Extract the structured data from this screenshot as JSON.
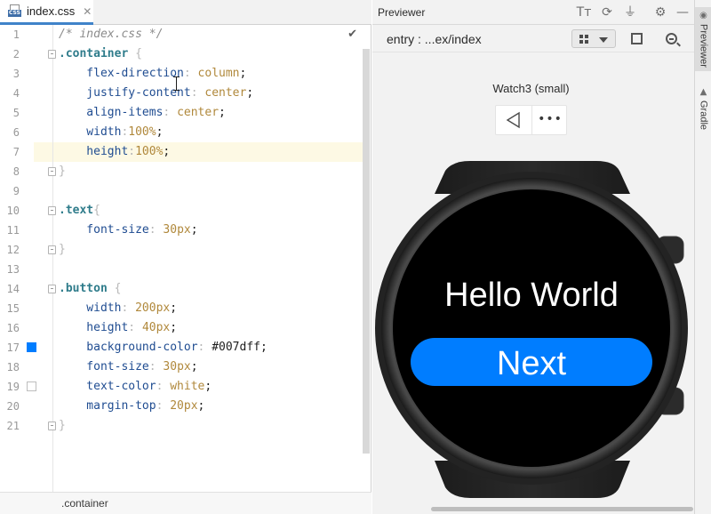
{
  "editor": {
    "tab": {
      "title": "index.css",
      "icon": "css-file-icon",
      "icon_text": "CSS",
      "close": "✕"
    },
    "lines": [
      {
        "n": "1",
        "tokens": [
          {
            "t": "/* index.css */",
            "c": "comment"
          }
        ]
      },
      {
        "n": "2",
        "fold": true,
        "tokens": [
          {
            "t": ".container",
            "c": "sel"
          },
          {
            "t": " {",
            "c": "brace"
          }
        ]
      },
      {
        "n": "3",
        "tokens": [
          {
            "t": "    flex-direction",
            "c": "prop"
          },
          {
            "t": ": ",
            "c": "brace"
          },
          {
            "t": "column",
            "c": "value"
          },
          {
            "t": ";",
            "c": "punct"
          }
        ]
      },
      {
        "n": "4",
        "tokens": [
          {
            "t": "    justify-content",
            "c": "prop"
          },
          {
            "t": ": ",
            "c": "brace"
          },
          {
            "t": "center",
            "c": "value"
          },
          {
            "t": ";",
            "c": "punct"
          }
        ]
      },
      {
        "n": "5",
        "tokens": [
          {
            "t": "    align-items",
            "c": "prop"
          },
          {
            "t": ": ",
            "c": "brace"
          },
          {
            "t": "center",
            "c": "value"
          },
          {
            "t": ";",
            "c": "punct"
          }
        ]
      },
      {
        "n": "6",
        "tokens": [
          {
            "t": "    width",
            "c": "prop"
          },
          {
            "t": ":",
            "c": "brace"
          },
          {
            "t": "100%",
            "c": "num"
          },
          {
            "t": ";",
            "c": "punct"
          }
        ]
      },
      {
        "n": "7",
        "current": true,
        "tokens": [
          {
            "t": "    height",
            "c": "prop"
          },
          {
            "t": ":",
            "c": "brace"
          },
          {
            "t": "100%",
            "c": "num"
          },
          {
            "t": ";",
            "c": "punct"
          }
        ]
      },
      {
        "n": "8",
        "fold": true,
        "tokens": [
          {
            "t": "}",
            "c": "brace"
          }
        ]
      },
      {
        "n": "9",
        "tokens": []
      },
      {
        "n": "10",
        "fold": true,
        "tokens": [
          {
            "t": ".text",
            "c": "sel"
          },
          {
            "t": "{",
            "c": "brace"
          }
        ]
      },
      {
        "n": "11",
        "tokens": [
          {
            "t": "    font-size",
            "c": "prop"
          },
          {
            "t": ": ",
            "c": "brace"
          },
          {
            "t": "30",
            "c": "num"
          },
          {
            "t": "px",
            "c": "unit"
          },
          {
            "t": ";",
            "c": "punct"
          }
        ]
      },
      {
        "n": "12",
        "fold": true,
        "tokens": [
          {
            "t": "}",
            "c": "brace"
          }
        ]
      },
      {
        "n": "13",
        "tokens": []
      },
      {
        "n": "14",
        "fold": true,
        "tokens": [
          {
            "t": ".button",
            "c": "sel"
          },
          {
            "t": " {",
            "c": "brace"
          }
        ]
      },
      {
        "n": "15",
        "tokens": [
          {
            "t": "    width",
            "c": "prop"
          },
          {
            "t": ": ",
            "c": "brace"
          },
          {
            "t": "200",
            "c": "num"
          },
          {
            "t": "px",
            "c": "unit"
          },
          {
            "t": ";",
            "c": "punct"
          }
        ]
      },
      {
        "n": "16",
        "tokens": [
          {
            "t": "    height",
            "c": "prop"
          },
          {
            "t": ": ",
            "c": "brace"
          },
          {
            "t": "40",
            "c": "num"
          },
          {
            "t": "px",
            "c": "unit"
          },
          {
            "t": ";",
            "c": "punct"
          }
        ]
      },
      {
        "n": "17",
        "swatch": "#007dff",
        "tokens": [
          {
            "t": "    background-color",
            "c": "prop"
          },
          {
            "t": ": ",
            "c": "brace"
          },
          {
            "t": "#007dff",
            "c": "hex"
          },
          {
            "t": ";",
            "c": "punct"
          }
        ]
      },
      {
        "n": "18",
        "tokens": [
          {
            "t": "    font-size",
            "c": "prop"
          },
          {
            "t": ": ",
            "c": "brace"
          },
          {
            "t": "30",
            "c": "num"
          },
          {
            "t": "px",
            "c": "unit"
          },
          {
            "t": ";",
            "c": "punct"
          }
        ]
      },
      {
        "n": "19",
        "swatch": "#ffffff",
        "tokens": [
          {
            "t": "    text-color",
            "c": "prop"
          },
          {
            "t": ": ",
            "c": "brace"
          },
          {
            "t": "white",
            "c": "value"
          },
          {
            "t": ";",
            "c": "punct"
          }
        ]
      },
      {
        "n": "20",
        "tokens": [
          {
            "t": "    margin-top",
            "c": "prop"
          },
          {
            "t": ": ",
            "c": "brace"
          },
          {
            "t": "20",
            "c": "num"
          },
          {
            "t": "px",
            "c": "unit"
          },
          {
            "t": ";",
            "c": "punct"
          }
        ]
      },
      {
        "n": "21",
        "fold": true,
        "tokens": [
          {
            "t": "}",
            "c": "brace"
          }
        ]
      }
    ],
    "inspection_icon": "checkmark-icon",
    "inspection_glyph": "✔",
    "breadcrumb": ".container"
  },
  "previewer": {
    "title": "Previewer",
    "header_icons": [
      {
        "name": "font-size-icon",
        "glyph": "Tт"
      },
      {
        "name": "refresh-icon",
        "glyph": "⟳"
      },
      {
        "name": "plug-icon",
        "glyph": "⏚"
      },
      {
        "name": "settings-icon",
        "glyph": "⚙"
      },
      {
        "name": "minimize-icon",
        "glyph": "—"
      }
    ],
    "entry_path": "entry : ...ex/index",
    "device_name": "Watch3 (small)",
    "more_glyph": "•••",
    "screen": {
      "text": "Hello World",
      "button_label": "Next",
      "button_color": "#007dff",
      "screen_color": "#000000"
    }
  },
  "toolstrip": {
    "tabs": [
      {
        "label": "Previewer",
        "icon": "eye-icon",
        "glyph": "◉",
        "active": true
      },
      {
        "label": "Gradle",
        "icon": "elephant-icon",
        "glyph": "▲",
        "active": false
      }
    ]
  },
  "colors": {
    "accent_tab": "#4083c9",
    "current_line": "#fdf9e4"
  }
}
